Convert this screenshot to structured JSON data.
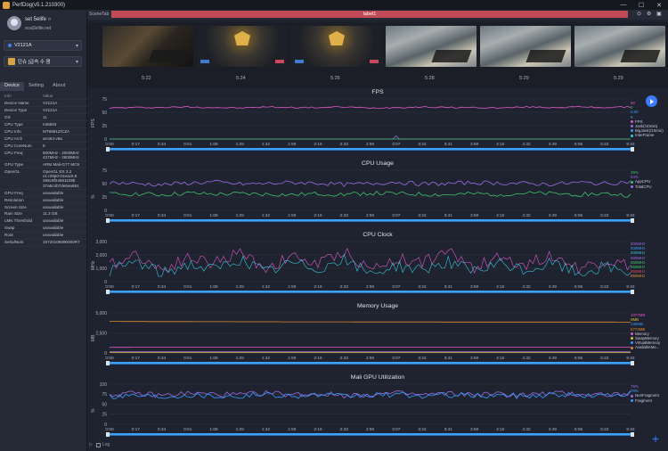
{
  "window": {
    "title": "PerfDog(v5.1.210300)",
    "controls": [
      "—",
      "☐",
      "✕"
    ]
  },
  "user": {
    "name": "set 5elife ○",
    "email": "xcai3elife.net"
  },
  "device_select": {
    "value": "V2121A"
  },
  "app_select": {
    "value": "탄슈 [급속 수 잼"
  },
  "sidebar_tabs": [
    "Device",
    "Setting",
    "About"
  ],
  "device_info": {
    "headers": [
      "Info",
      "Value"
    ],
    "rows": [
      [
        "Device Name",
        "V2121A"
      ],
      [
        "Device Type",
        "V2121A"
      ],
      [
        "OS",
        "11"
      ],
      [
        "CPU Type",
        "mt6893"
      ],
      [
        "CPU Info",
        "MT6891Z/CZA"
      ],
      [
        "CPU Arch",
        "arm64-v8a"
      ],
      [
        "CPU CoreNum",
        "8"
      ],
      [
        "CPU Freq",
        "500MHz - 2000MHz\n437MHz - 2600MHz"
      ],
      [
        "GPU Type",
        "ARM Mali-G77 MC9"
      ],
      [
        "OpenGL",
        "OpenGL ES 3.2\nv1.r29p0-01eac0.8\n286c9f24651109b\n37a5c4b7de6ea691"
      ],
      [
        "GPU Freq",
        "unavailable"
      ],
      [
        "Resolution",
        "unavailable"
      ],
      [
        "Screen Size",
        "unavailable"
      ],
      [
        "Ram Size",
        "11.3 GB"
      ],
      [
        "LMK Threshold",
        "unavailable"
      ],
      [
        "Swap",
        "unavailable"
      ],
      [
        "Root",
        "unavailable"
      ],
      [
        "SerialNum",
        "15720108090000R7"
      ]
    ]
  },
  "scene": {
    "tab_label": "SceneTab",
    "label": "label1"
  },
  "thumbnails": [
    {
      "time": "5:22",
      "kind": "dark"
    },
    {
      "time": "5:24",
      "kind": "award"
    },
    {
      "time": "5:26",
      "kind": "award"
    },
    {
      "time": "5:28",
      "kind": "map"
    },
    {
      "time": "5:29",
      "kind": "map"
    },
    {
      "time": "5:29",
      "kind": "map"
    }
  ],
  "time_ticks": [
    "0:00",
    "0:17",
    "0:34",
    "0:51",
    "1:08",
    "1:25",
    "1:42",
    "1:59",
    "2:16",
    "2:33",
    "2:50",
    "3:07",
    "3:24",
    "3:41",
    "3:58",
    "4:15",
    "4:32",
    "4:49",
    "5:06",
    "5:23",
    "5:34"
  ],
  "colors": {
    "pink": "#e05ac8",
    "purple": "#9a6ae0",
    "green": "#3fc26a",
    "blue": "#3a9bff",
    "cyan": "#38c7d8",
    "red": "#e0485a",
    "yellow": "#e0c040",
    "orange": "#e08a30",
    "timeline": "#3aa3ff"
  },
  "charts": [
    {
      "title": "FPS",
      "ylabel": "FPS",
      "yticks": [
        "75",
        "50",
        "25",
        "0"
      ],
      "ymax": 75,
      "legend_values": [
        {
          "text": "60",
          "color": "pink"
        },
        {
          "text": "0",
          "color": "green"
        },
        {
          "text": "0.00",
          "color": "blue"
        },
        {
          "text": "0",
          "color": "cyan"
        }
      ],
      "legend": [
        {
          "text": "FPS",
          "color": "pink"
        },
        {
          "text": "Jank(/10min)",
          "color": "purple"
        },
        {
          "text": "BigJank(/10min)",
          "color": "blue"
        },
        {
          "text": "InterFrame",
          "color": "cyan"
        }
      ]
    },
    {
      "title": "CPU Usage",
      "ylabel": "%",
      "yticks": [
        "75",
        "50",
        "25",
        "0"
      ],
      "ymax": 75,
      "legend_values": [
        {
          "text": "39%",
          "color": "green"
        },
        {
          "text": "54%",
          "color": "purple"
        }
      ],
      "legend": [
        {
          "text": "AppCPU",
          "color": "green"
        },
        {
          "text": "TotalCPU",
          "color": "purple"
        }
      ]
    },
    {
      "title": "CPU Clock",
      "ylabel": "MHz",
      "yticks": [
        "3,000",
        "2,000",
        "1,000",
        "0"
      ],
      "ymax": 3000,
      "legend_values": [
        {
          "text": "600MHz",
          "color": "purple"
        },
        {
          "text": "500MHz",
          "color": "blue"
        },
        {
          "text": "500MHz",
          "color": "cyan"
        },
        {
          "text": "500MHz",
          "color": "purple"
        },
        {
          "text": "850MHz",
          "color": "green"
        },
        {
          "text": "850MHz",
          "color": "green"
        },
        {
          "text": "850MHz",
          "color": "red"
        },
        {
          "text": "850MHz",
          "color": "orange"
        }
      ],
      "legend": []
    },
    {
      "title": "Memory Usage",
      "ylabel": "MB",
      "yticks": [
        "5,000",
        "2,500",
        "0"
      ],
      "ymax": 7500,
      "legend_values": [
        {
          "text": "1077MB",
          "color": "pink"
        },
        {
          "text": "0MB",
          "color": "yellow"
        },
        {
          "text": "230MB",
          "color": "blue"
        },
        {
          "text": "5774MB",
          "color": "orange"
        }
      ],
      "legend": [
        {
          "text": "Memory",
          "color": "pink"
        },
        {
          "text": "SwapMemory",
          "color": "yellow"
        },
        {
          "text": "VirtualMemory",
          "color": "blue"
        },
        {
          "text": "AvailableMe...",
          "color": "orange"
        }
      ]
    },
    {
      "title": "Mali GPU Utilization",
      "ylabel": "%",
      "yticks": [
        "100",
        "75",
        "50",
        "25",
        "0"
      ],
      "ymax": 100,
      "legend_values": [
        {
          "text": "76%",
          "color": "purple"
        },
        {
          "text": "78%",
          "color": "blue"
        }
      ],
      "legend": [
        {
          "text": "NonFragment",
          "color": "purple"
        },
        {
          "text": "Fragment",
          "color": "blue"
        }
      ]
    }
  ],
  "chart_data": [
    {
      "type": "line",
      "title": "FPS",
      "ylabel": "FPS",
      "ylim": [
        0,
        75
      ],
      "x": [
        "0:00",
        "0:17",
        "0:34",
        "0:51",
        "1:08",
        "1:25",
        "1:42",
        "1:59",
        "2:16",
        "2:33",
        "2:50",
        "3:07",
        "3:24",
        "3:41",
        "3:58",
        "4:15",
        "4:32",
        "4:49",
        "5:06",
        "5:23",
        "5:34"
      ],
      "series": [
        {
          "name": "FPS",
          "values": [
            58,
            59,
            59,
            60,
            59,
            58,
            60,
            59,
            59,
            60,
            58,
            59,
            60,
            59,
            59,
            58,
            60,
            59,
            60,
            59,
            60
          ]
        },
        {
          "name": "Jank(/10min)",
          "values": [
            0,
            0,
            0,
            0,
            0,
            0,
            0,
            0,
            0,
            0,
            0,
            5,
            0,
            0,
            0,
            0,
            0,
            0,
            0,
            0,
            0
          ]
        }
      ]
    },
    {
      "type": "line",
      "title": "CPU Usage",
      "ylabel": "%",
      "ylim": [
        0,
        75
      ],
      "x": [
        "0:00",
        "0:17",
        "0:34",
        "0:51",
        "1:08",
        "1:25",
        "1:42",
        "1:59",
        "2:16",
        "2:33",
        "2:50",
        "3:07",
        "3:24",
        "3:41",
        "3:58",
        "4:15",
        "4:32",
        "4:49",
        "5:06",
        "5:23",
        "5:34"
      ],
      "series": [
        {
          "name": "AppCPU",
          "values": [
            30,
            31,
            29,
            32,
            30,
            31,
            30,
            29,
            31,
            30,
            32,
            31,
            30,
            29,
            31,
            30,
            32,
            31,
            30,
            31,
            28
          ]
        },
        {
          "name": "TotalCPU",
          "values": [
            52,
            50,
            48,
            51,
            53,
            49,
            50,
            52,
            51,
            48,
            50,
            53,
            49,
            50,
            52,
            51,
            50,
            49,
            52,
            50,
            54
          ]
        }
      ]
    },
    {
      "type": "line",
      "title": "CPU Clock",
      "ylabel": "MHz",
      "ylim": [
        0,
        3000
      ],
      "x": [
        "0:00",
        "0:17",
        "0:34",
        "0:51",
        "1:08",
        "1:25",
        "1:42",
        "1:59",
        "2:16",
        "2:33",
        "2:50",
        "3:07",
        "3:24",
        "3:41",
        "3:58",
        "4:15",
        "4:32",
        "4:49",
        "5:06",
        "5:23",
        "5:34"
      ],
      "series": [
        {
          "name": "",
          "values": [
            1200,
            2100,
            900,
            1800,
            1400,
            2200,
            1000,
            1900,
            1300,
            2300,
            900,
            1700,
            1500,
            2200,
            1100,
            1800,
            1300,
            2000,
            1000,
            1600,
            1200
          ]
        },
        {
          "name": "",
          "values": [
            800,
            1500,
            600,
            1300,
            900,
            1700,
            700,
            1400,
            1000,
            1600,
            600,
            1200,
            900,
            1500,
            700,
            1300,
            800,
            1400,
            600,
            1100,
            700
          ]
        }
      ]
    },
    {
      "type": "line",
      "title": "Memory Usage",
      "ylabel": "MB",
      "ylim": [
        0,
        7500
      ],
      "x": [
        "0:00",
        "0:17",
        "0:34",
        "0:51",
        "1:08",
        "1:25",
        "1:42",
        "1:59",
        "2:16",
        "2:33",
        "2:50",
        "3:07",
        "3:24",
        "3:41",
        "3:58",
        "4:15",
        "4:32",
        "4:49",
        "5:06",
        "5:23",
        "5:34"
      ],
      "series": [
        {
          "name": "Memory",
          "values": [
            1050,
            1060,
            1062,
            1065,
            1066,
            1068,
            1068,
            1069,
            1070,
            1070,
            1071,
            1072,
            1072,
            1073,
            1074,
            1074,
            1075,
            1075,
            1076,
            1076,
            1077
          ]
        },
        {
          "name": "AvailableMe...",
          "values": [
            5900,
            5880,
            5870,
            5860,
            5850,
            5840,
            5830,
            5820,
            5815,
            5810,
            5805,
            5800,
            5795,
            5790,
            5788,
            5785,
            5782,
            5780,
            5778,
            5776,
            5774
          ]
        },
        {
          "name": "VirtualMemory",
          "values": [
            230,
            230,
            230,
            230,
            230,
            230,
            230,
            230,
            230,
            230,
            230,
            230,
            230,
            230,
            230,
            230,
            230,
            230,
            230,
            230,
            230
          ]
        }
      ]
    },
    {
      "type": "line",
      "title": "Mali GPU Utilization",
      "ylabel": "%",
      "ylim": [
        0,
        100
      ],
      "x": [
        "0:00",
        "0:17",
        "0:34",
        "0:51",
        "1:08",
        "1:25",
        "1:42",
        "1:59",
        "2:16",
        "2:33",
        "2:50",
        "3:07",
        "3:24",
        "3:41",
        "3:58",
        "4:15",
        "4:32",
        "4:49",
        "5:06",
        "5:23",
        "5:34"
      ],
      "series": [
        {
          "name": "NonFragment",
          "values": [
            74,
            76,
            72,
            77,
            75,
            73,
            78,
            74,
            76,
            72,
            75,
            77,
            73,
            76,
            74,
            75,
            73,
            77,
            75,
            74,
            76
          ]
        },
        {
          "name": "Fragment",
          "values": [
            70,
            73,
            69,
            74,
            71,
            70,
            75,
            71,
            73,
            69,
            72,
            74,
            70,
            73,
            71,
            72,
            70,
            74,
            72,
            71,
            78
          ]
        }
      ]
    }
  ],
  "footer": {
    "checkbox_label": "Log"
  }
}
